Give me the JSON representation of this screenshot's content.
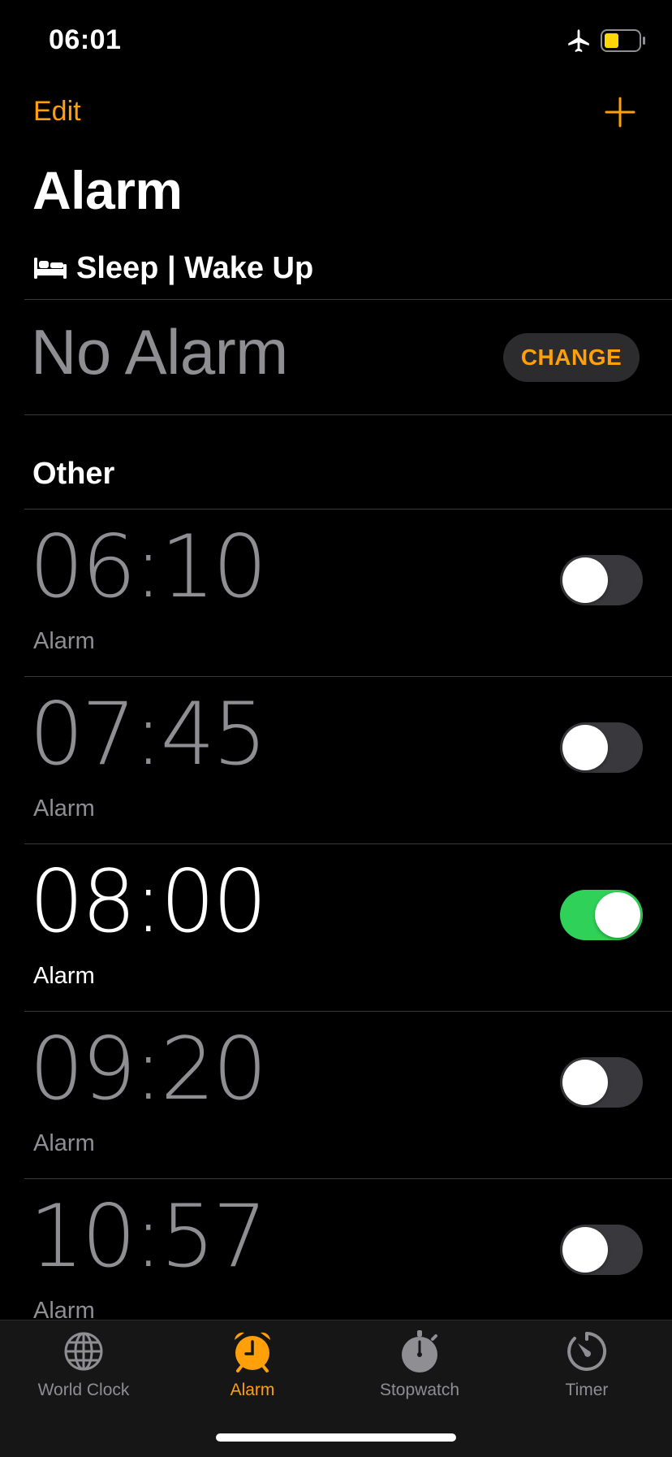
{
  "status_bar": {
    "time": "06:01",
    "airplane_mode": true,
    "battery_color": "#ffd60a"
  },
  "nav": {
    "edit_label": "Edit",
    "add_icon": "plus-icon"
  },
  "title": "Alarm",
  "sleep": {
    "icon": "bed-icon",
    "title": "Sleep | Wake Up",
    "no_alarm_text": "No Alarm",
    "change_label": "CHANGE"
  },
  "other": {
    "title": "Other",
    "alarms": [
      {
        "time": "06:10",
        "label": "Alarm",
        "enabled": false
      },
      {
        "time": "07:45",
        "label": "Alarm",
        "enabled": false
      },
      {
        "time": "08:00",
        "label": "Alarm",
        "enabled": true
      },
      {
        "time": "09:20",
        "label": "Alarm",
        "enabled": false
      },
      {
        "time": "10:57",
        "label": "Alarm",
        "enabled": false
      }
    ]
  },
  "tabs": [
    {
      "label": "World Clock",
      "icon": "globe-icon",
      "active": false
    },
    {
      "label": "Alarm",
      "icon": "alarm-clock-icon",
      "active": true
    },
    {
      "label": "Stopwatch",
      "icon": "stopwatch-icon",
      "active": false
    },
    {
      "label": "Timer",
      "icon": "timer-icon",
      "active": false
    }
  ],
  "colors": {
    "accent": "#ff9f0a",
    "toggle_on": "#30d158",
    "inactive_text": "#8e8e93",
    "background": "#000000"
  }
}
